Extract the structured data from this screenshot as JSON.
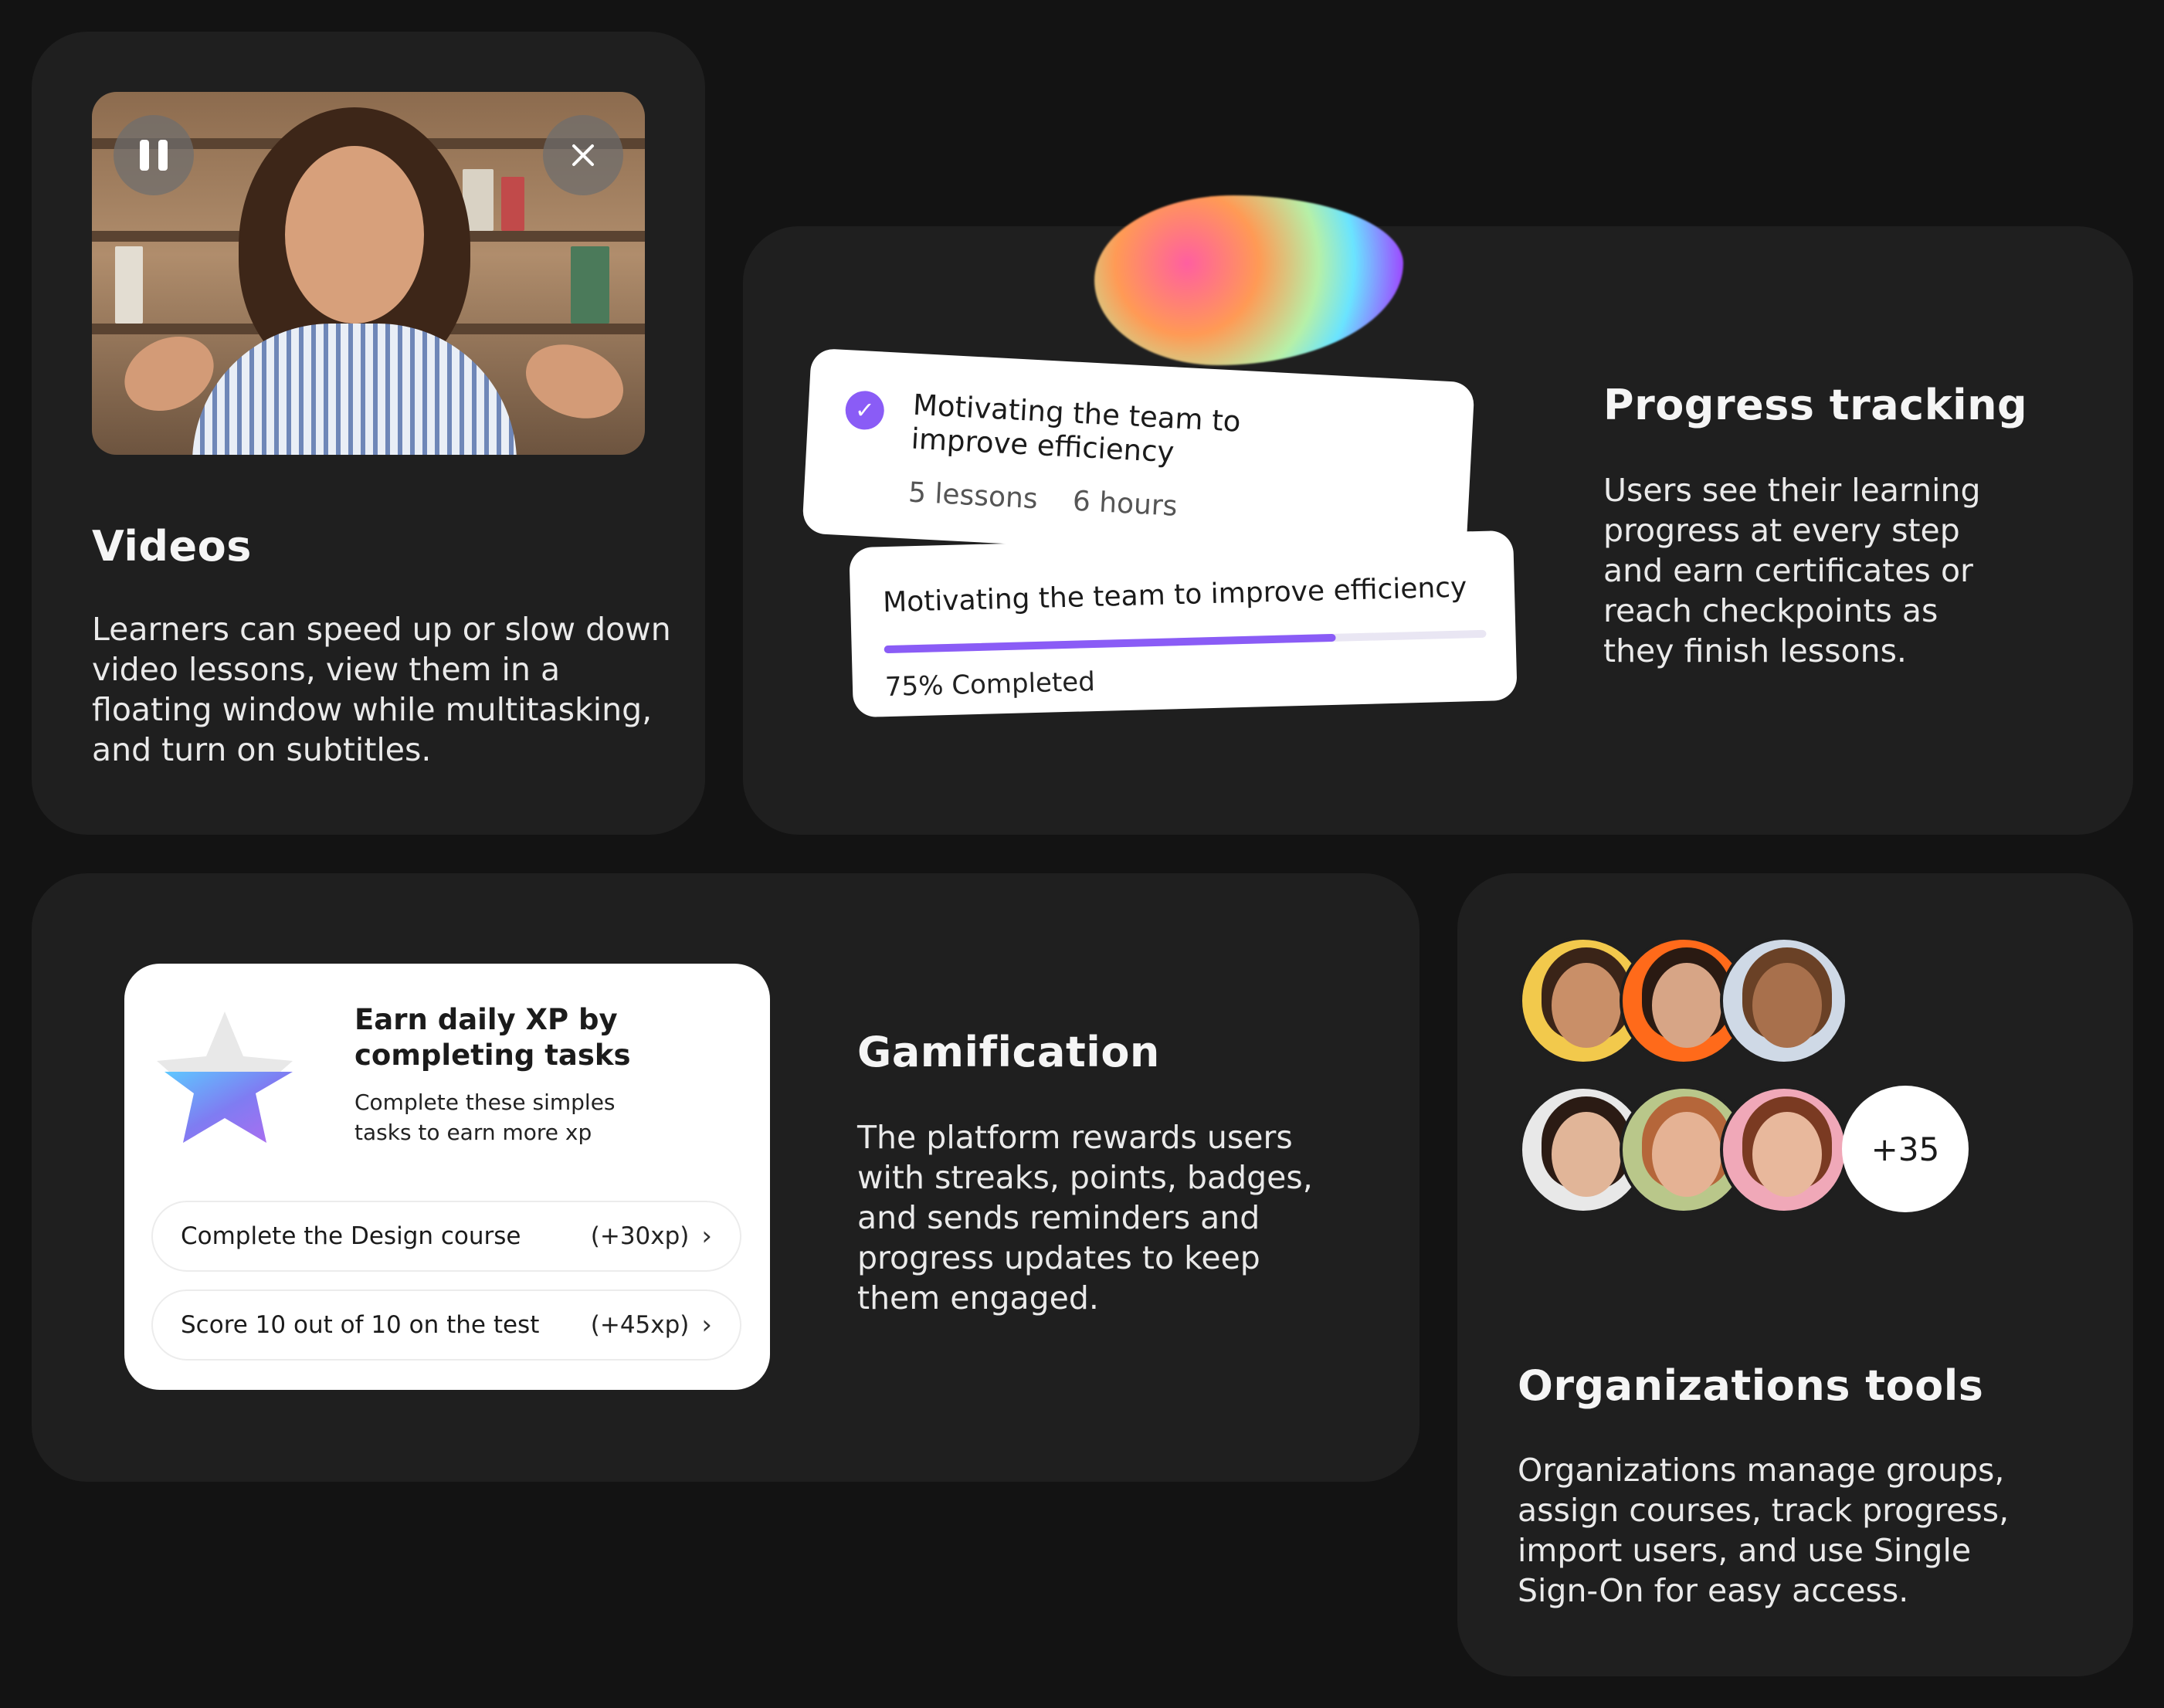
{
  "videos": {
    "title": "Videos",
    "description": "Learners can speed up or slow down video lessons, view them in a floating window while multitasking, and turn on subtitles."
  },
  "progress": {
    "title": "Progress tracking",
    "description": "Users see their learning progress at every step and earn certificates or reach checkpoints as they finish lessons.",
    "course_card": {
      "title": "Motivating the team to improve efficiency",
      "lessons": "5 lessons",
      "hours": "6 hours"
    },
    "progress_card": {
      "title": "Motivating the team to improve efficiency",
      "percent": 75,
      "label": "75% Completed"
    }
  },
  "gamification": {
    "title": "Gamification",
    "description": "The platform rewards users with streaks, points, badges, and sends reminders and progress updates to keep them engaged.",
    "xp_card": {
      "title": "Earn daily XP by completing tasks",
      "subtitle": "Complete these simples tasks to earn more xp",
      "tasks": [
        {
          "label": "Complete the Design course",
          "xp": "(+30xp)"
        },
        {
          "label": "Score 10 out of 10 on the test",
          "xp": "(+45xp)"
        }
      ]
    }
  },
  "org": {
    "title": "Organizations tools",
    "description": "Organizations manage groups, assign courses, track progress, import users, and use Single Sign-On for easy access.",
    "more_count": "+35"
  },
  "colors": {
    "accent": "#8a5cf6",
    "card_bg": "#1f1f1f",
    "page_bg": "#131313"
  }
}
